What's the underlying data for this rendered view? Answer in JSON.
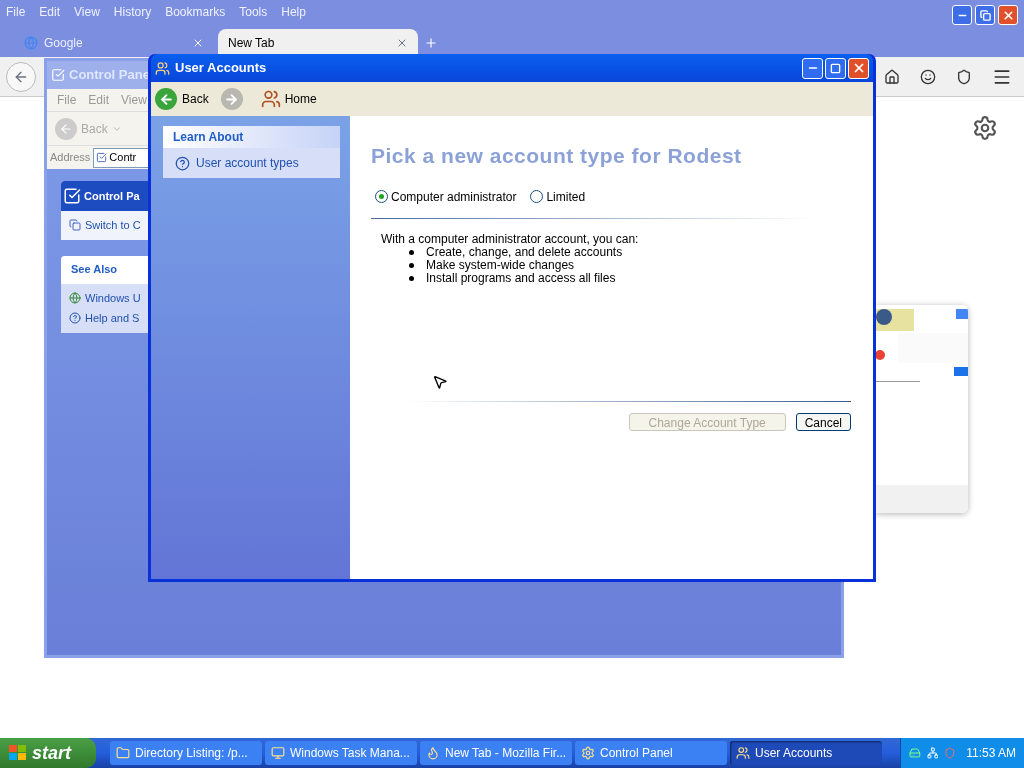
{
  "browser": {
    "menu": [
      "File",
      "Edit",
      "View",
      "History",
      "Bookmarks",
      "Tools",
      "Help"
    ],
    "tabs": [
      {
        "label": "Google",
        "selected": false
      },
      {
        "label": "New Tab",
        "selected": true
      }
    ]
  },
  "control_panel": {
    "title": "Control Pane",
    "menu": [
      "File",
      "Edit",
      "View"
    ],
    "back": "Back",
    "address_label": "Address",
    "address_value": "Contr",
    "task_panel": {
      "title": "Control Pa",
      "items": [
        "Switch to C"
      ]
    },
    "see_also": {
      "title": "See Also",
      "items": [
        "Windows U",
        "Help and S"
      ]
    }
  },
  "user_accounts": {
    "title": "User Accounts",
    "toolbar": {
      "back": "Back",
      "home": "Home"
    },
    "learn_about": {
      "title": "Learn About",
      "items": [
        "User account types"
      ]
    },
    "heading": "Pick a new account type for Rodest",
    "options": [
      {
        "label": "Computer administrator",
        "selected": true
      },
      {
        "label": "Limited",
        "selected": false
      }
    ],
    "description": "With a computer administrator account, you can:",
    "bullets": [
      "Create, change, and delete accounts",
      "Make system-wide changes",
      "Install programs and access all files"
    ],
    "buttons": [
      {
        "label": "Change Account Type",
        "disabled": true
      },
      {
        "label": "Cancel",
        "disabled": false
      }
    ]
  },
  "taskbar": {
    "start": "start",
    "items": [
      {
        "label": "Directory Listing: /p...",
        "selected": false
      },
      {
        "label": "Windows Task Mana...",
        "selected": false
      },
      {
        "label": "New Tab - Mozilla Fir...",
        "selected": false
      },
      {
        "label": "Control Panel",
        "selected": false
      },
      {
        "label": "User Accounts",
        "selected": true
      }
    ],
    "clock": "11:53 AM"
  }
}
